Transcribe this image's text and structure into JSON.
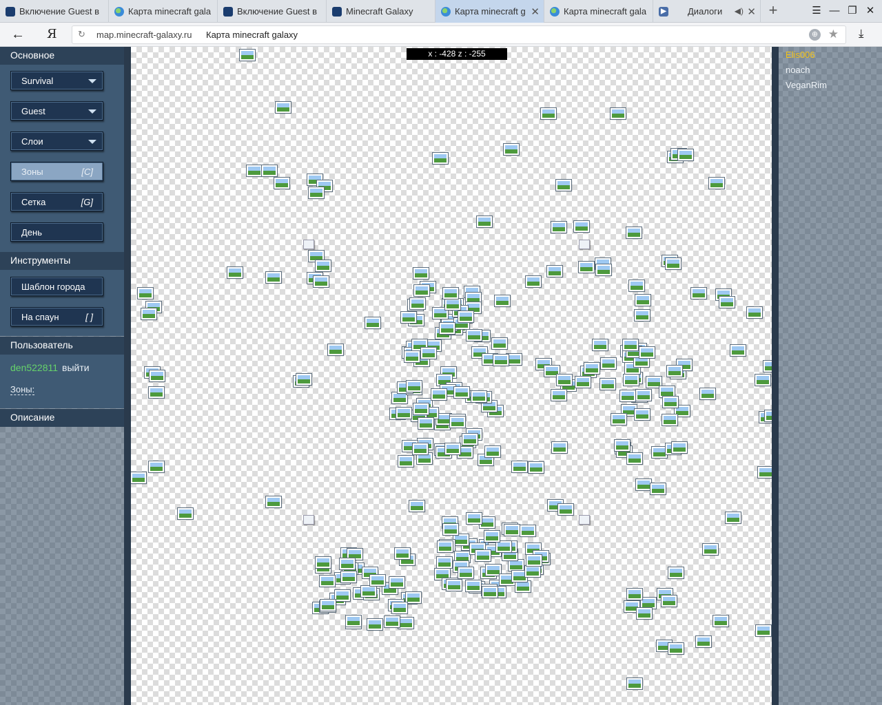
{
  "browser": {
    "tabs": [
      {
        "title": "Включение Guest в",
        "icon": "minecraft-icon",
        "active": false
      },
      {
        "title": "Карта minecraft gala",
        "icon": "globe-icon",
        "active": false
      },
      {
        "title": "Включение Guest в",
        "icon": "minecraft-icon",
        "active": false
      },
      {
        "title": "Minecraft Galaxy",
        "icon": "minecraft-icon",
        "active": false
      },
      {
        "title": "Карта minecraft g",
        "icon": "globe-icon",
        "active": true
      },
      {
        "title": "Карта minecraft gala",
        "icon": "globe-icon",
        "active": false
      },
      {
        "title": "Диалоги",
        "icon": "dialogs-icon",
        "active": false
      }
    ],
    "new_tab": "+",
    "menu": "☰",
    "minimize": "—",
    "restore": "❐",
    "close": "✕",
    "back": "←",
    "logo": "Я",
    "url_domain": "map.minecraft-galaxy.ru",
    "url_title": "Карта minecraft galaxy"
  },
  "sidebar": {
    "main_header": "Основное",
    "world_select": "Survival",
    "role_select": "Guest",
    "layers_select": "Слои",
    "zones_button": "Зоны",
    "zones_hotkey": "[C]",
    "grid_button": "Сетка",
    "grid_hotkey": "[G]",
    "day_button": "День",
    "tools_header": "Инструменты",
    "city_template_button": "Шаблон города",
    "spawn_button": "На спаун",
    "spawn_hotkey": "[ ]",
    "user_header": "Пользователь",
    "username": "den522811",
    "logout": "выйти",
    "zones_label": "Зоны:",
    "description_header": "Описание"
  },
  "map": {
    "coordinates": "x : -428 z : -255"
  },
  "players": [
    "Elis006",
    "noach",
    "VeganRim"
  ],
  "colors": {
    "accent_user": "#66d36a",
    "player_highlight": "#f5c518",
    "panel": "#2d4258"
  }
}
